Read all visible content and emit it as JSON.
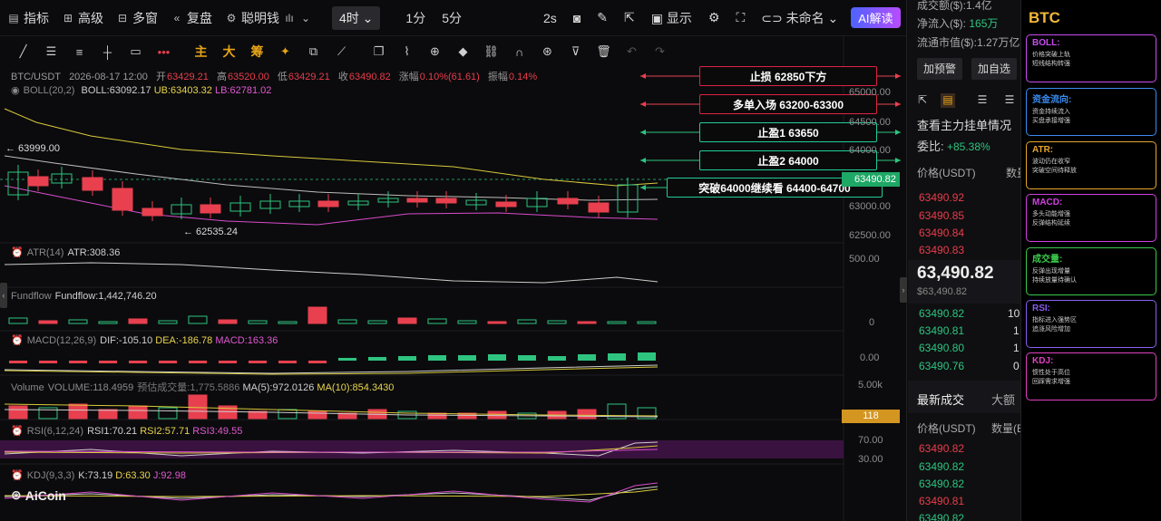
{
  "toolbar": {
    "indicators": "指标",
    "advanced": "高级",
    "multiwin": "多窗",
    "review": "复盘",
    "smartmoney": "聪明钱",
    "timeframe": "4时",
    "tf1m": "1分",
    "tf5m": "5分",
    "interval": "2s",
    "display": "显示",
    "unnamed": "未命名",
    "ai": "AI解读"
  },
  "drawbar": {
    "main": "主",
    "big": "大",
    "chip": "筹"
  },
  "info": {
    "pair": "BTC/USDT",
    "time": "2026-08-17 12:00",
    "open_l": "开",
    "open": "63429.21",
    "high_l": "高",
    "high": "63520.00",
    "low_l": "低",
    "low": "63429.21",
    "close_l": "收",
    "close": "63490.82",
    "chg_l": "涨幅",
    "chg": "0.10%(61.61)",
    "amp_l": "振幅",
    "amp": "0.14%"
  },
  "boll": {
    "name": "BOLL(20,2)",
    "mid": "BOLL:63092.17",
    "ub": "UB:63403.32",
    "lb": "LB:62781.02"
  },
  "annot": {
    "high_mark": "← 63999.00",
    "low_mark": "← 62535.24"
  },
  "signals": [
    {
      "text": "止损 62850下方",
      "color": "#e8404f"
    },
    {
      "text": "多单入场 63200-63300",
      "color": "#e8404f"
    },
    {
      "text": "止盈1 63650",
      "color": "#2ec480"
    },
    {
      "text": "止盈2 64000",
      "color": "#2ec480"
    },
    {
      "text": "突破64000继续看 64400-64700",
      "color": "#2ec480"
    }
  ],
  "price_axis": [
    "65000.00",
    "64500.00",
    "64000.00",
    "63000.00",
    "62500.00"
  ],
  "last_price_tag": "63490.82",
  "atr": {
    "name": "ATR(14)",
    "value": "ATR:308.36",
    "axis": "500.00"
  },
  "fundflow": {
    "name": "Fundflow",
    "value": "Fundflow:1,442,746.20",
    "axis": "0"
  },
  "macd": {
    "name": "MACD(12,26,9)",
    "dif": "DIF:-105.10",
    "dea": "DEA:-186.78",
    "macd": "MACD:163.36",
    "axis": "0.00"
  },
  "volume": {
    "name": "Volume",
    "vol": "VOLUME:118.4959",
    "est": "预估成交量:1,775.5886",
    "ma5": "MA(5):972.0126",
    "ma10": "MA(10):854.3430",
    "axis": "5.00k",
    "tag": "118"
  },
  "rsi": {
    "name": "RSI(6,12,24)",
    "r1": "RSI1:70.21",
    "r2": "RSI2:57.71",
    "r3": "RSI3:49.55",
    "axis1": "70.00",
    "axis2": "30.00"
  },
  "kdj": {
    "name": "KDJ(9,3,3)",
    "k": "K:73.19",
    "d": "D:63.30",
    "j": "J:92.98"
  },
  "logo": "AiCoin",
  "right": {
    "turnover": "成交额($):1.4亿",
    "netin_l": "净流入($):",
    "netin": "165万",
    "mcap": "流通市值($):1.27万亿",
    "alert_btn": "加预警",
    "fav_btn": "加自选",
    "orders_title": "查看主力挂单情况",
    "ratio_l": "委比:",
    "ratio": "+85.38%",
    "price_hdr": "价格(USDT)",
    "qty_hdr": "数量",
    "asks": [
      "63490.92",
      "63490.85",
      "63490.84",
      "63490.83"
    ],
    "last": "63,490.82",
    "last_sub": "$63,490.82",
    "bids": [
      "63490.82",
      "63490.81",
      "63490.80",
      "63490.76"
    ],
    "bid_qty": [
      "10",
      "1",
      "1",
      "0"
    ],
    "trades_tab": "最新成交",
    "big_tab": "大额",
    "trades_price_hdr": "价格(USDT)",
    "trades_qty_hdr": "数量(B",
    "trades": [
      "63490.82",
      "63490.82",
      "63490.82",
      "63490.81",
      "63490.82"
    ]
  },
  "btc": {
    "title": "BTC",
    "cards": [
      {
        "title": "BOLL:",
        "color": "#c84cf0",
        "lines": [
          "价格突破上轨",
          "短线结构转强"
        ]
      },
      {
        "title": "资金流向:",
        "color": "#3a8cf0",
        "lines": [
          "资金持续流入",
          "买盘承接增强"
        ]
      },
      {
        "title": "ATR:",
        "color": "#e8a52a",
        "lines": [
          "波动仍在收窄",
          "突破空间待释放"
        ]
      },
      {
        "title": "MACD:",
        "color": "#d040e0",
        "lines": [
          "多头动能增强",
          "反弹结构延续"
        ]
      },
      {
        "title": "成交量:",
        "color": "#3ac84a",
        "lines": [
          "反弹出现增量",
          "持续放量待确认"
        ]
      },
      {
        "title": "RSI:",
        "color": "#8a5cf0",
        "lines": [
          "指标进入强势区",
          "追涨风险增加"
        ]
      },
      {
        "title": "KDJ:",
        "color": "#e040c0",
        "lines": [
          "惯性处于高位",
          "回踩需求增强"
        ]
      }
    ]
  }
}
